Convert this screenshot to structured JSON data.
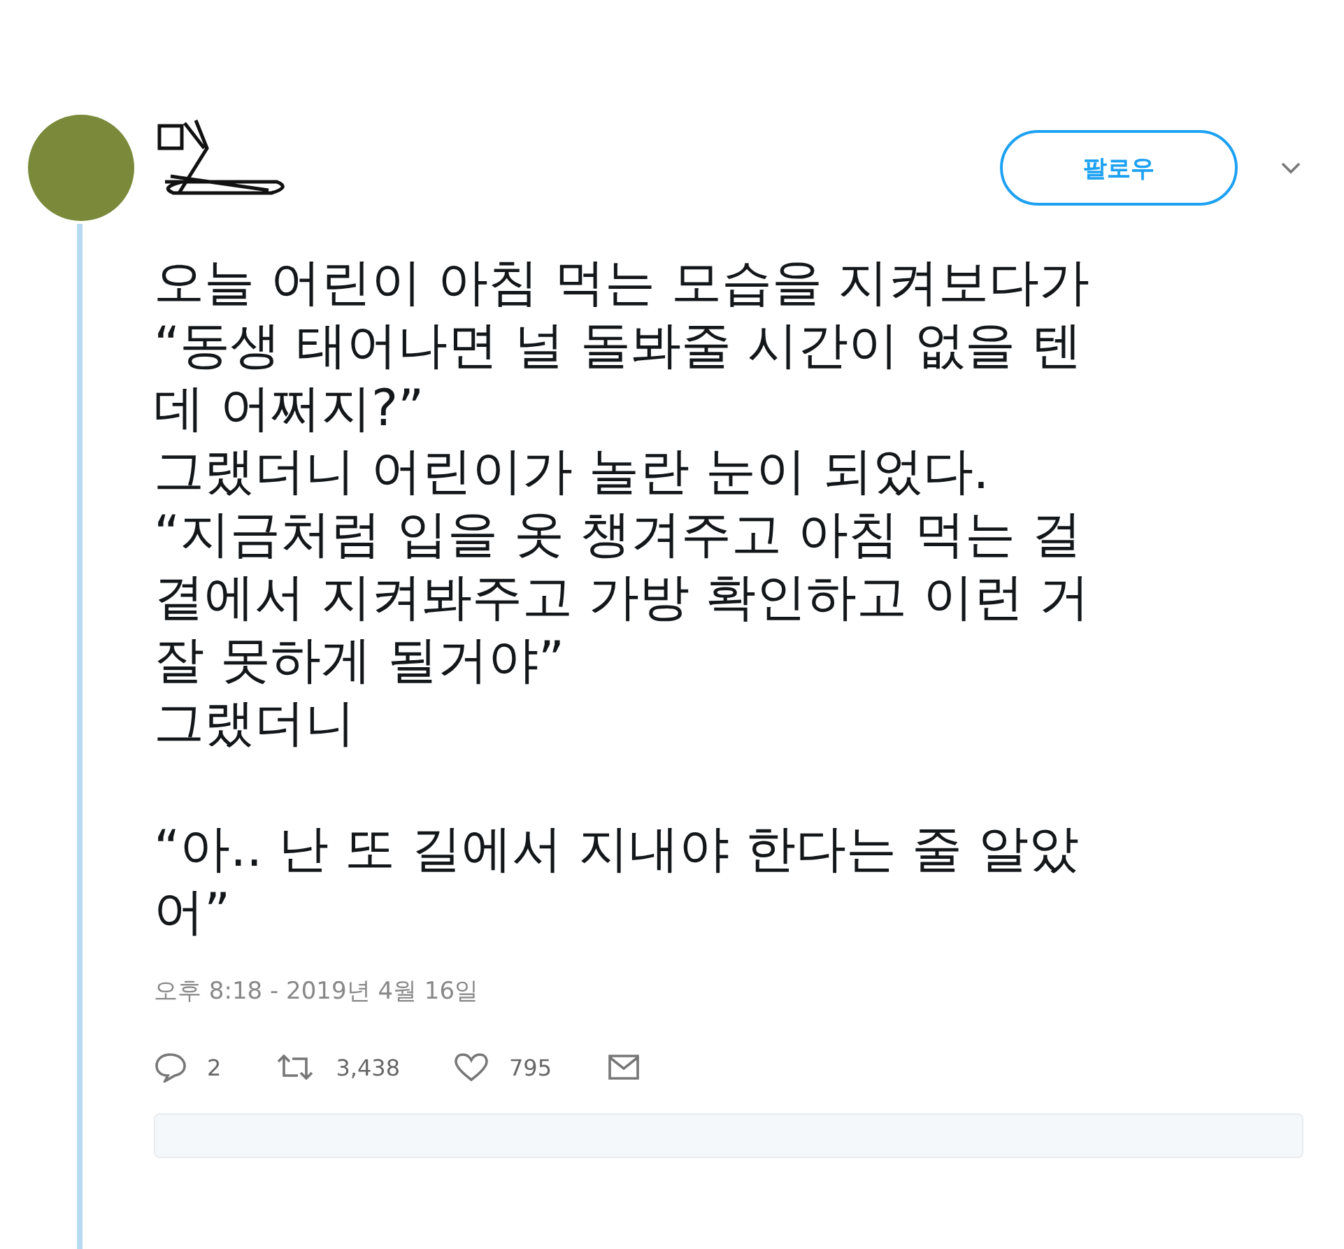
{
  "follow_button": {
    "label": "팔로우"
  },
  "tweet": {
    "text": "오늘 어린이 아침 먹는 모습을 지켜보다가\n“동생 태어나면 널 돌봐줄 시간이 없을 텐\n데 어쩌지?”\n그랬더니 어린이가 놀란 눈이 되었다.\n“지금처럼 입을 옷 챙겨주고 아침 먹는 걸\n곁에서 지켜봐주고 가방 확인하고 이런 거\n잘 못하게 될거야”\n그랬더니\n\n“아.. 난 또 길에서 지내야 한다는 줄 알았\n어”",
    "timestamp": "오후 8:18 - 2019년 4월 16일"
  },
  "actions": [
    {
      "kind": "reply",
      "count": "2"
    },
    {
      "kind": "retweet",
      "count": "3,438"
    },
    {
      "kind": "like",
      "count": "795"
    },
    {
      "kind": "message"
    }
  ]
}
